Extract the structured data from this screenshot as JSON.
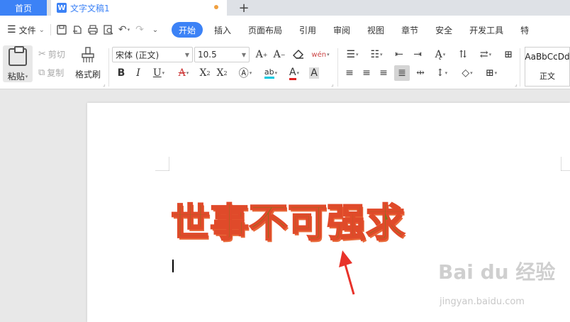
{
  "tabs": {
    "home_label": "首页",
    "document_label": "文字文稿1",
    "document_icon_letter": "W",
    "new_tab_symbol": "+"
  },
  "menubar": {
    "file_label": "文件",
    "tabs": [
      "开始",
      "插入",
      "页面布局",
      "引用",
      "审阅",
      "视图",
      "章节",
      "安全",
      "开发工具",
      "特"
    ],
    "active_tab": "开始"
  },
  "ribbon": {
    "paste_label": "粘贴",
    "cut_label": "剪切",
    "copy_label": "复制",
    "format_painter_label": "格式刷",
    "font_name": "宋体 (正文)",
    "font_size": "10.5",
    "style_preview": "AaBbCcDd",
    "style_name": "正文",
    "phonetic_label": "wén"
  },
  "document": {
    "heading_text": "世事不可强求"
  },
  "watermark": {
    "brand": "Bai du 经验",
    "url": "jingyan.baidu.com"
  },
  "colors": {
    "accent": "#3c82f6",
    "heading_fill": "#7a7a1a",
    "heading_outline": "#e04a2a",
    "arrow": "#e8322a"
  }
}
